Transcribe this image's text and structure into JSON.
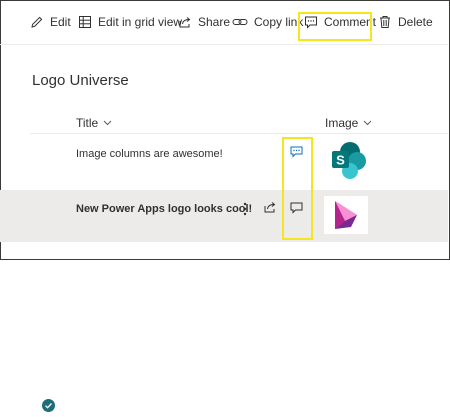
{
  "toolbar": {
    "edit": "Edit",
    "grid": "Edit in grid view",
    "share": "Share",
    "copy_link": "Copy link",
    "comment": "Comment",
    "delete": "Delete"
  },
  "list": {
    "title": "Logo Universe",
    "columns": {
      "title": "Title",
      "image": "Image"
    },
    "rows": [
      {
        "title": "Image columns are awesome!",
        "image": "SharePoint logo",
        "selected": false
      },
      {
        "title": "New Power Apps logo looks cool!",
        "image": "Power Apps logo",
        "selected": true
      }
    ]
  },
  "icons": {
    "edit": "pencil-icon",
    "grid": "grid-icon",
    "share": "share-icon",
    "copy_link": "link-icon",
    "comment": "comment-icon",
    "delete": "trash-icon",
    "more": "more-vertical-icon",
    "check": "checkmark-icon"
  },
  "colors": {
    "accent": "#1b6e7a",
    "highlight": "#f5e51f",
    "selected_row": "#edebe9",
    "comment_blue": "#0f6cbd"
  }
}
